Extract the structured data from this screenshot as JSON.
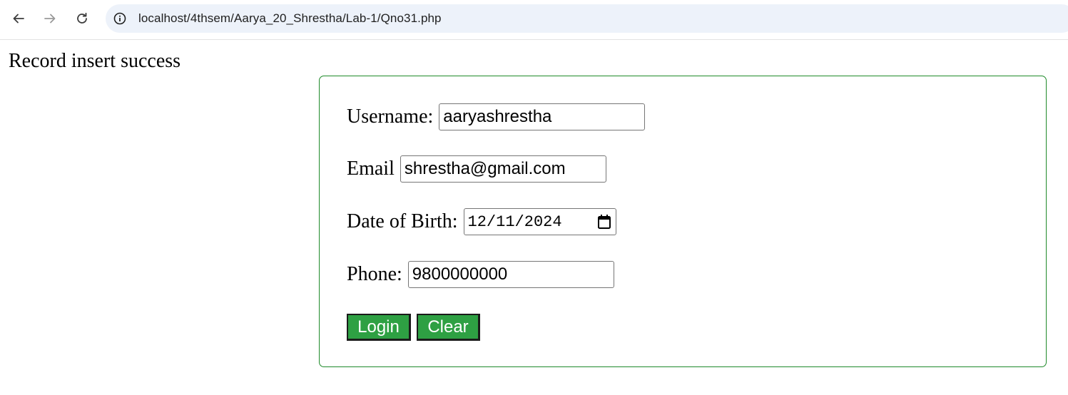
{
  "browser": {
    "url": "localhost/4thsem/Aarya_20_Shrestha/Lab-1/Qno31.php",
    "icons": [
      "back-arrow-icon",
      "forward-arrow-icon",
      "reload-icon",
      "site-info-icon"
    ]
  },
  "page": {
    "status_message": "Record insert success",
    "form": {
      "border_color": "#1f8a2a",
      "fields": {
        "username": {
          "label": "Username:",
          "value": "aaryashrestha"
        },
        "email": {
          "label": "Email",
          "value": "shrestha@gmail.com"
        },
        "dob": {
          "label": "Date of Birth:",
          "value": "12/11/2024"
        },
        "phone": {
          "label": "Phone:",
          "value": "9800000000"
        }
      },
      "buttons": {
        "login": "Login",
        "clear": "Clear",
        "color": "#2ea043"
      }
    }
  }
}
